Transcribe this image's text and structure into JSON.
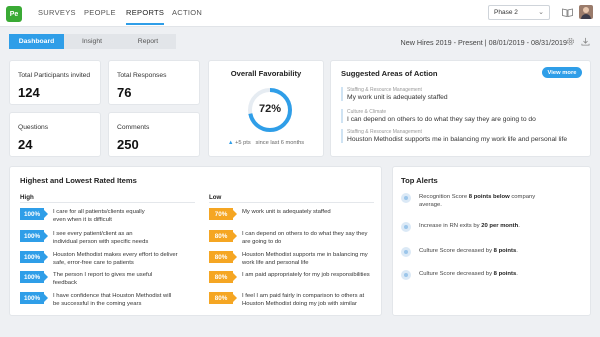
{
  "nav": {
    "logo": "Pe",
    "items": [
      "SURVEYS",
      "PEOPLE",
      "REPORTS",
      "ACTION"
    ],
    "active": "REPORTS",
    "phase_select": "Phase 2"
  },
  "tabs": [
    "Dashboard",
    "Insight",
    "Report"
  ],
  "active_tab": "Dashboard",
  "date_range": "New Hires 2019 - Present | 08/01/2019 - 08/31/2019",
  "stats": {
    "participants": {
      "label": "Total Participants invited",
      "value": "124"
    },
    "responses": {
      "label": "Total Responses",
      "value": "76"
    },
    "questions": {
      "label": "Questions",
      "value": "24"
    },
    "comments": {
      "label": "Comments",
      "value": "250"
    }
  },
  "favorability": {
    "title": "Overall Favorability",
    "percent_label": "72%",
    "percent": 72,
    "change": "+5 pts",
    "since": "since last 6 months",
    "ring_color": "#2f9ee8"
  },
  "suggested": {
    "title": "Suggested Areas of Action",
    "button": "View more",
    "items": [
      {
        "category": "Staffing & Resource Management",
        "text": "My work unit is adequately staffed"
      },
      {
        "category": "Culture & Climate",
        "text": "I can depend on others to do what they say they are going to do"
      },
      {
        "category": "Staffing & Resource Management",
        "text": "Houston Methodist supports me in balancing my work life and personal life"
      }
    ]
  },
  "ratings": {
    "title": "Highest and Lowest Rated Items",
    "high_label": "High",
    "low_label": "Low",
    "high": [
      {
        "pct": "100%",
        "line1": "I care for all patients/clients equally",
        "line2": "even when it is difficult"
      },
      {
        "pct": "100%",
        "line1": "I see every patient/client as an",
        "line2": "individual person with specific needs"
      },
      {
        "pct": "100%",
        "line1": "Houston Methodist makes every effort to deliver",
        "line2": "safe, error-free care to patients"
      },
      {
        "pct": "100%",
        "line1": "The person I report to gives me useful",
        "line2": "feedback"
      },
      {
        "pct": "100%",
        "line1": "I have confidence that Houston Methodist will",
        "line2": "be successful in the coming years"
      }
    ],
    "low": [
      {
        "pct": "70%",
        "line1": "My work unit is adequately staffed",
        "line2": ""
      },
      {
        "pct": "80%",
        "line1": "I can depend on others to do what they say they",
        "line2": "are going to do"
      },
      {
        "pct": "80%",
        "line1": "Houston Methodist supports me in balancing my",
        "line2": "work life and personal life"
      },
      {
        "pct": "80%",
        "line1": "I am paid appropriately for my job responsibilities",
        "line2": ""
      },
      {
        "pct": "80%",
        "line1": "I feel I am paid fairly in comparison to others at",
        "line2": "Houston Methodist doing my job with similar"
      }
    ]
  },
  "alerts": {
    "title": "Top Alerts",
    "items": [
      {
        "pre": "Recognition Score ",
        "bold": "8 points below",
        "post": " company",
        "line2": "average."
      },
      {
        "pre": "Increase in RN exits by ",
        "bold": "20 per month",
        "post": ".",
        "line2": ""
      },
      {
        "pre": "Culture Score decreased by ",
        "bold": "8 points",
        "post": ".",
        "line2": ""
      },
      {
        "pre": "Culture Score decreased by ",
        "bold": "8 points",
        "post": ".",
        "line2": ""
      }
    ]
  }
}
